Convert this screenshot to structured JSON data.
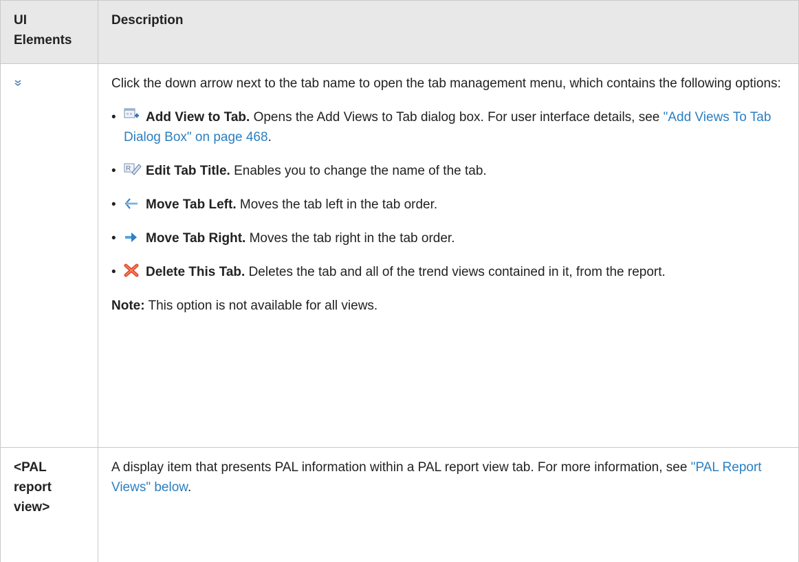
{
  "header": {
    "col1": "UI\nElements",
    "col1_line1": "UI",
    "col1_line2": "Elements",
    "col2": "Description"
  },
  "rows": [
    {
      "intro": "Click the down arrow next to the tab name to open the tab management menu, which contains the following options:",
      "items": [
        {
          "icon": "add-view-icon",
          "title": "Add View to Tab.",
          "text": " Opens the Add Views to Tab dialog box. For user interface details, see ",
          "link": "\"Add Views To Tab Dialog Box\" on page 468",
          "after": "."
        },
        {
          "icon": "edit-title-icon",
          "title": "Edit Tab Title.",
          "text": " Enables you to change the name of the tab."
        },
        {
          "icon": "arrow-left-icon",
          "title": "Move Tab Left.",
          "text": " Moves the tab left in the tab order."
        },
        {
          "icon": "arrow-right-icon",
          "title": "Move Tab Right.",
          "text": " Moves the tab right in the tab order."
        },
        {
          "icon": "delete-x-icon",
          "title": "Delete This Tab.",
          "text": " Deletes the tab and all of the trend views contained in it, from the report."
        }
      ],
      "note_label": "Note:",
      "note_text": " This option is not available for all views."
    },
    {
      "element": "<PAL report view>",
      "element_lines": [
        "<PAL",
        "report",
        "view>"
      ],
      "text": "A display item that presents PAL information within a PAL report view tab. For more information, see ",
      "link": "\"PAL Report Views\" below",
      "after": "."
    }
  ],
  "colors": {
    "header_bg": "#e8e8e8",
    "border": "#c9c9c9",
    "link": "#2b7fc1"
  }
}
